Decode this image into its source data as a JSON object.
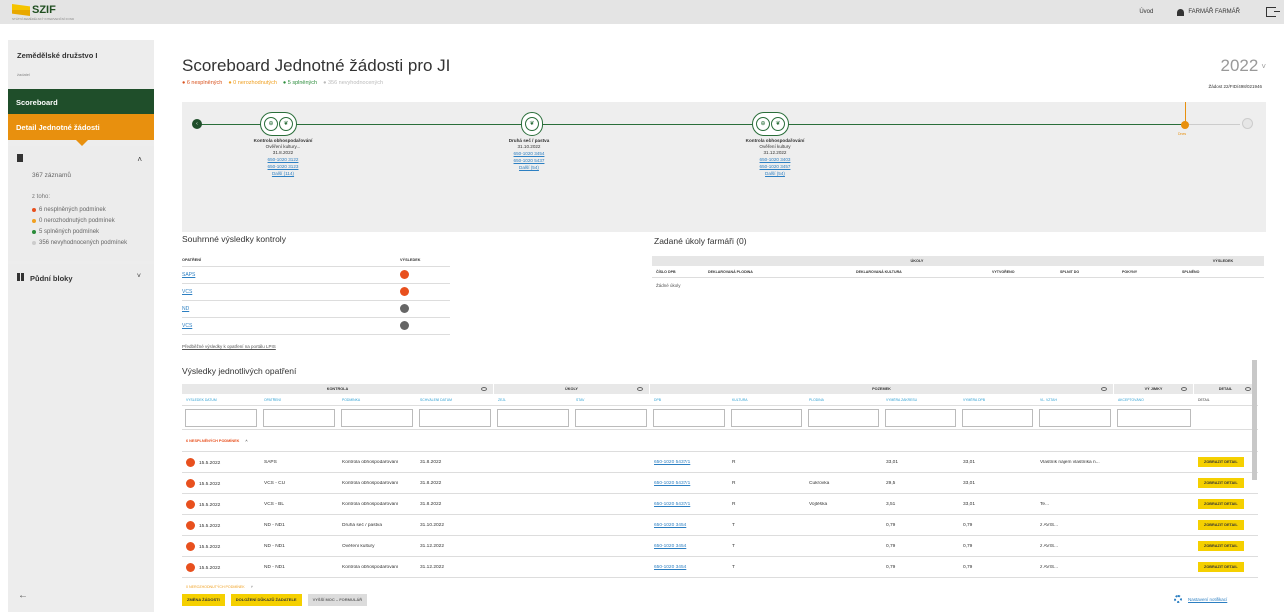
{
  "header": {
    "logo_text": "SZIF",
    "logo_sub": "STÁTNÍ ZEMĚDĚLSKÝ INTERVENČNÍ FOND",
    "nav_home": "Úvod",
    "user_label": "FARMÁŘ FARMÁŘ"
  },
  "sidebar": {
    "farm_name": "Zemědělské družstvo I",
    "farm_sub": "žadatel",
    "scoreboard_label": "Scoreboard",
    "detail_label": "Detail Jednotné žádosti",
    "records_count": "367 záznamů",
    "of_which": "z toho:",
    "conditions": [
      {
        "label": "6 nesplněných podmínek",
        "color": "#e8501e"
      },
      {
        "label": "0 nerozhodnutých podmínek",
        "color": "#f0a020"
      },
      {
        "label": "5 splněných podmínek",
        "color": "#2a8c3a"
      },
      {
        "label": "356 nevyhodnocených podmínek",
        "color": "#cccccc"
      }
    ],
    "puda_label": "Půdní bloky"
  },
  "page": {
    "title": "Scoreboard Jednotné žádosti pro JI",
    "stats": {
      "unfulfilled": "● 6 nesplněných",
      "undecided": "● 0 nerozhodnutých",
      "fulfilled": "● 5 splněných",
      "unevaluated": "● 356 nevyhodnocených"
    },
    "year": "2022",
    "zadost": "Žádost 22/FID/498/021946"
  },
  "timeline": {
    "events": [
      {
        "t1": "Kontrola obhospodařování",
        "t2": "Ověření kultury...",
        "date": "31.8.2022",
        "links": [
          "650-1020 3122",
          "650-1020 3123"
        ],
        "more": "Další (114)"
      },
      {
        "t1": "Druhá seč / pastva",
        "t2": "",
        "date": "31.10.2022",
        "links": [
          "650-1020 3454",
          "650-1020 5437"
        ],
        "more": "Další (54)"
      },
      {
        "t1": "Kontrola obhospodařování",
        "t2": "Ověření kultury",
        "date": "31.12.2022",
        "links": [
          "650-1020 3403",
          "650-1020 3457"
        ],
        "more": "Další (54)"
      }
    ],
    "today_label": "Dnes"
  },
  "summary": {
    "title": "Souhrnné výsledky kontroly",
    "col_opatreni": "OPATŘENÍ",
    "col_vysledek": "VÝSLEDEK",
    "rows": [
      {
        "name": "SAPS",
        "color": "#e8501e"
      },
      {
        "name": "VCS",
        "color": "#e8501e"
      },
      {
        "name": "ND",
        "color": "#666666"
      },
      {
        "name": "VCS",
        "color": "#666666"
      }
    ],
    "footer_link": "Předběžné výsledky k opatření na portálu LPIS"
  },
  "tasks": {
    "title": "Zadané úkoly farmáři (0)",
    "group_ukoly": "ÚKOLY",
    "group_vysledek": "VÝSLEDEK",
    "cols": [
      "ČÍSLO DPB",
      "DEKLAROVANÁ PLODINA",
      "DEKLAROVANÁ KULTURA",
      "VYTVOŘENO",
      "SPLNIT DO",
      "POKYNY",
      "SPLNĚNO"
    ],
    "empty": "Žádné úkoly"
  },
  "results": {
    "title": "Výsledky jednotlivých opatření",
    "groups": [
      "KONTROLA",
      "ÚKOLY",
      "POZEMEK",
      "VÝ JIMKY",
      "DETAIL"
    ],
    "columns": [
      "VÝSLEDEK DATUM",
      "OPATŘENÍ",
      "PODMÍNKA",
      "SCHVÁLENÍ DATUM",
      "ZEJL",
      "STAV",
      "DPB",
      "KULTURA",
      "PLODINA",
      "VÝMĚRA ZÁKRESU",
      "VÝMĚRA DPB",
      "VL. VZTAH",
      "AKCEPTOVÁNO",
      "DETAIL"
    ],
    "group_unfulfilled": "6 NESPLNĚNÝCH PODMÍNEK",
    "rows": [
      {
        "date": "15.5.2022",
        "opatreni": "SAPS",
        "podminka": "Kontrola obhospodařování",
        "schvaleni": "31.8.2022",
        "dpb": "650-1020 5437/1",
        "kultura": "R",
        "plodina": "",
        "vymera_z": "33,01",
        "vymera_dpb": "33,01",
        "vztah": "Vlastník nájem vlastníka n..."
      },
      {
        "date": "15.5.2022",
        "opatreni": "VCS - CU",
        "podminka": "Kontrola obhospodařování",
        "schvaleni": "31.8.2022",
        "dpb": "650-1020 5437/1",
        "kultura": "R",
        "plodina": "Cukrovka",
        "vymera_z": "29,5",
        "vymera_dpb": "33,01",
        "vztah": ""
      },
      {
        "date": "15.5.2022",
        "opatreni": "VCS - BL",
        "podminka": "Kontrola obhospodařování",
        "schvaleni": "31.8.2022",
        "dpb": "650-1020 5437/1",
        "kultura": "R",
        "plodina": "Vojtěška",
        "vymera_z": "3,51",
        "vymera_dpb": "33,01",
        "vztah": "Te..."
      },
      {
        "date": "15.5.2022",
        "opatreni": "ND - ND1",
        "podminka": "Druhá seč / pastva",
        "schvaleni": "31.10.2022",
        "dpb": "650-1020 3454",
        "kultura": "T",
        "plodina": "",
        "vymera_z": "0,79",
        "vymera_dpb": "0,79",
        "vztah": "z AVIS..."
      },
      {
        "date": "15.5.2022",
        "opatreni": "ND - ND1",
        "podminka": "Ověření kultury",
        "schvaleni": "31.12.2022",
        "dpb": "650-1020 3454",
        "kultura": "T",
        "plodina": "",
        "vymera_z": "0,79",
        "vymera_dpb": "0,79",
        "vztah": "z AVIS..."
      },
      {
        "date": "15.5.2022",
        "opatreni": "ND - ND1",
        "podminka": "Kontrola obhospodařování",
        "schvaleni": "31.12.2022",
        "dpb": "650-1020 3454",
        "kultura": "T",
        "plodina": "",
        "vymera_z": "0,79",
        "vymera_dpb": "0,79",
        "vztah": "z AVIS..."
      }
    ],
    "detail_btn": "ZOBRAZIT DETAIL",
    "group_undecided": "0 NEROZHODNUTÝCH PODMÍNEK"
  },
  "footer": {
    "btn1": "ZMĚNA ŽÁDOSTI",
    "btn2": "DOLOŽENÍ DŮKAZŮ ŽADATELE",
    "btn3": "VYŠŠÍ MOC – FORMULÁŘ",
    "notif": "Nastavení notifikací"
  }
}
